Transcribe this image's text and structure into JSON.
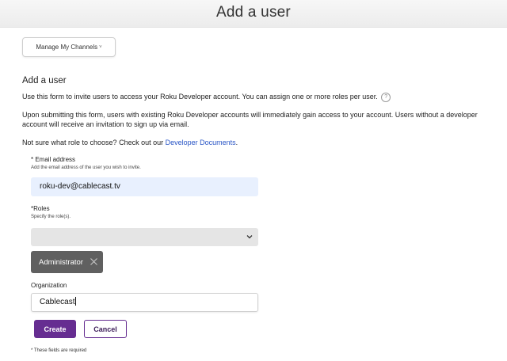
{
  "header": {
    "title": "Add a user"
  },
  "toolbar": {
    "manage_channels_label": "Manage My Channels",
    "manage_channels_chevron": "˅"
  },
  "form": {
    "section_title": "Add a user",
    "intro": "Use this form to invite users to access your Roku Developer account. You can assign one or more roles per user.",
    "help_icon": "?",
    "submit_note": "Upon submitting this form, users with existing Roku Developer accounts will immediately gain access to your account. Users without a developer account will receive an invitation to sign up via email.",
    "role_prompt": "Not sure what role to choose? Check out our ",
    "role_link": "Developer Documents",
    "role_prompt_end": ".",
    "email": {
      "label": "* Email address",
      "help": "Add the email address of the user you wish to invite.",
      "value": "roku-dev@cablecast.tv"
    },
    "roles": {
      "label": "*Roles",
      "help": "Specify the role(s).",
      "selected": [
        "Administrator"
      ]
    },
    "organization": {
      "label": "Organization",
      "value": "Cablecast"
    },
    "create_label": "Create",
    "cancel_label": "Cancel",
    "required_note": "* These fields are required"
  },
  "colors": {
    "accent": "#662d91",
    "link": "#2a56c6",
    "autofill": "#e8f0fe",
    "tag": "#606060"
  },
  "icons": [
    "help-icon",
    "chevron-down-icon",
    "close-icon"
  ]
}
